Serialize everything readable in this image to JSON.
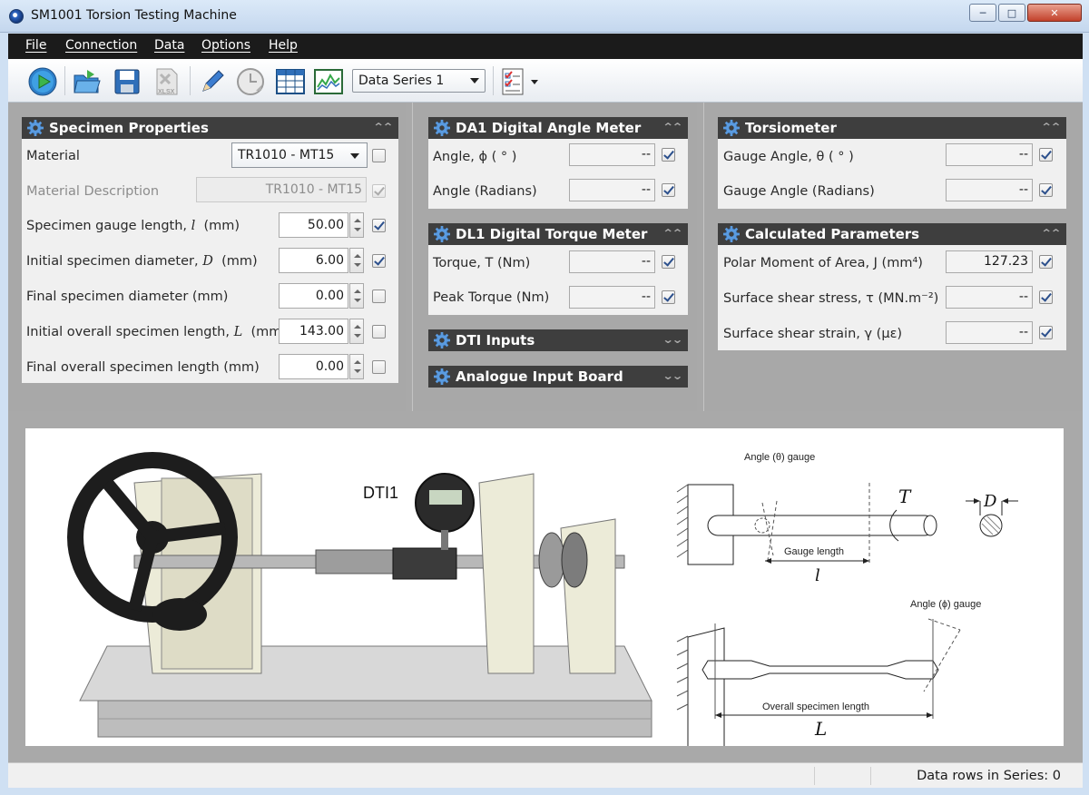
{
  "window": {
    "title": "SM1001 Torsion Testing Machine"
  },
  "menu": [
    "File",
    "Connection",
    "Data",
    "Options",
    "Help"
  ],
  "toolbar": {
    "icons": [
      "play-icon",
      "open-folder-icon",
      "save-icon",
      "export-xlsx-icon",
      "pencil-icon",
      "clock-icon",
      "table-icon",
      "chart-icon",
      "checklist-icon"
    ],
    "xlsx_label": "XLSX",
    "series_selected": "Data Series 1"
  },
  "specimen": {
    "title": "Specimen Properties",
    "material_label": "Material",
    "material_value": "TR1010 - MT15",
    "description_label": "Material Description",
    "description_value": "TR1010 - MT15",
    "rows": [
      {
        "label_pre": "Specimen gauge length, ",
        "symbol": "l",
        "label_post": "  (mm)",
        "value": "50.00",
        "checked": true
      },
      {
        "label_pre": "Initial specimen diameter, ",
        "symbol": "D",
        "label_post": "  (mm)",
        "value": "6.00",
        "checked": true
      },
      {
        "label_pre": "Final specimen diameter  (mm)",
        "symbol": "",
        "label_post": "",
        "value": "0.00",
        "checked": false
      },
      {
        "label_pre": "Initial overall specimen length, ",
        "symbol": "L",
        "label_post": "  (mm)",
        "value": "143.00",
        "checked": false
      },
      {
        "label_pre": "Final overall specimen length  (mm)",
        "symbol": "",
        "label_post": "",
        "value": "0.00",
        "checked": false
      }
    ]
  },
  "da1": {
    "title": "DA1 Digital Angle Meter",
    "rows": [
      {
        "label": "Angle, ϕ  ( ° )",
        "value": "--"
      },
      {
        "label": "Angle  (Radians)",
        "value": "--"
      }
    ]
  },
  "dl1": {
    "title": "DL1 Digital Torque Meter",
    "rows": [
      {
        "label": "Torque, T  (Nm)",
        "value": "--"
      },
      {
        "label": "Peak Torque  (Nm)",
        "value": "--"
      }
    ]
  },
  "dti": {
    "title": "DTI Inputs"
  },
  "analogue": {
    "title": "Analogue Input Board"
  },
  "torsiometer": {
    "title": "Torsiometer",
    "rows": [
      {
        "label": "Gauge Angle, θ  ( ° )",
        "value": "--"
      },
      {
        "label": "Gauge Angle  (Radians)",
        "value": "--"
      }
    ]
  },
  "calc": {
    "title": "Calculated Parameters",
    "rows": [
      {
        "label": "Polar Moment of Area, J  (mm⁴)",
        "value": "127.23"
      },
      {
        "label": "Surface shear stress, τ  (MN.m⁻²)",
        "value": "--"
      },
      {
        "label": "Surface shear strain, γ  (με)",
        "value": "--"
      }
    ]
  },
  "diagram": {
    "dti_label": "DTI1",
    "theta_gauge": "Angle (θ) gauge",
    "phi_gauge": "Angle (ϕ) gauge",
    "gauge_length": "Gauge length",
    "l_symbol": "l",
    "torque_symbol": "T",
    "diameter_symbol": "D",
    "overall_length": "Overall specimen length",
    "L_symbol": "L"
  },
  "status": {
    "text": "Data rows in Series: 0"
  }
}
